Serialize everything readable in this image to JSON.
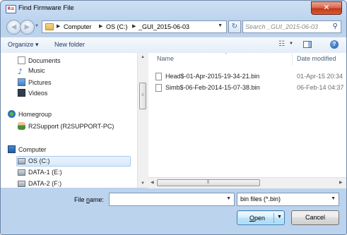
{
  "window": {
    "app_icon": "R≡",
    "title": "Find Firmware File",
    "close_glyph": "✕"
  },
  "address": {
    "breadcrumbs": [
      "Computer",
      "OS (C:)",
      "_GUI_2015-06-03"
    ],
    "search_placeholder": "Search _GUI_2015-06-03"
  },
  "toolbar": {
    "organize_label": "Organize ▾",
    "new_folder_label": "New folder"
  },
  "nav": {
    "items": [
      {
        "label": "Documents",
        "icon": "documents-icon"
      },
      {
        "label": "Music",
        "icon": "music-icon"
      },
      {
        "label": "Pictures",
        "icon": "pictures-icon"
      },
      {
        "label": "Videos",
        "icon": "videos-icon"
      },
      {
        "label": "Homegroup",
        "icon": "homegroup-icon"
      },
      {
        "label": "R2Support (R2SUPPORT-PC)",
        "icon": "user-icon"
      },
      {
        "label": "Computer",
        "icon": "computer-icon"
      },
      {
        "label": "OS (C:)",
        "icon": "drive-icon",
        "selected": true
      },
      {
        "label": "DATA-1 (E:)",
        "icon": "drive-icon"
      },
      {
        "label": "DATA-2 (F:)",
        "icon": "drive-icon"
      }
    ]
  },
  "files": {
    "columns": {
      "name": "Name",
      "date": "Date modified"
    },
    "rows": [
      {
        "name": "Head$-01-Apr-2015-19-34-21.bin",
        "date": "01-Apr-15 20:34"
      },
      {
        "name": "Simb$-06-Feb-2014-15-07-38.bin",
        "date": "06-Feb-14 04:37"
      }
    ]
  },
  "bottom": {
    "filename_label_pre": "File ",
    "filename_label_u": "n",
    "filename_label_post": "ame:",
    "filename_value": "",
    "filter_value": "bin files (*.bin)",
    "open_u": "O",
    "open_rest": "pen",
    "cancel_label": "Cancel"
  },
  "colors": {
    "title_bg": "#cddff3",
    "close_red": "#c23a16",
    "selection": "#d8e9fb"
  }
}
